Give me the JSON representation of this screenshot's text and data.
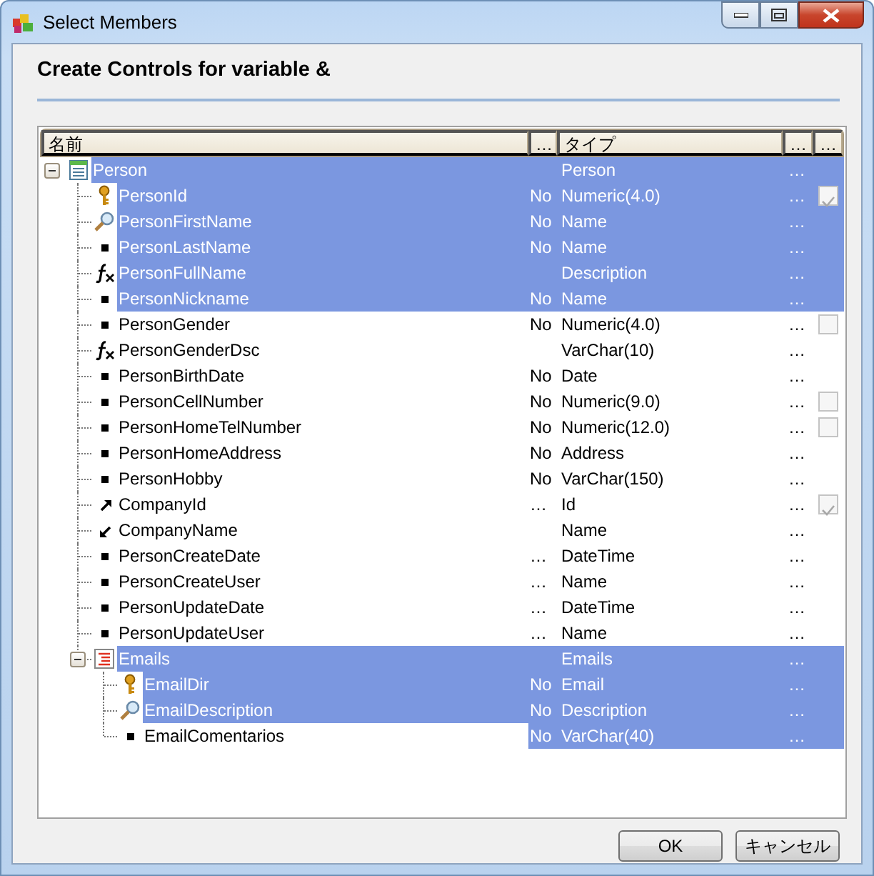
{
  "window": {
    "title": "Select Members"
  },
  "heading": "Create Controls for variable &",
  "columns": [
    {
      "label": "名前"
    },
    {
      "label": "…"
    },
    {
      "label": "タイプ"
    },
    {
      "label": "…"
    },
    {
      "label": "…"
    }
  ],
  "tree": [
    {
      "name": "Person",
      "kind": "table",
      "type": "Person",
      "more": "…",
      "selected": true,
      "name_selected": true,
      "expanded": true,
      "children": [
        {
          "name": "PersonId",
          "kind": "key",
          "nullable": "No",
          "type": "Numeric(4.0)",
          "more": "…",
          "checked": true,
          "selected": true,
          "name_selected": true
        },
        {
          "name": "PersonFirstName",
          "kind": "search",
          "nullable": "No",
          "type": "Name",
          "more": "…",
          "selected": true,
          "name_selected": true
        },
        {
          "name": "PersonLastName",
          "kind": "attribute",
          "nullable": "No",
          "type": "Name",
          "more": "…",
          "selected": true,
          "name_selected": true
        },
        {
          "name": "PersonFullName",
          "kind": "formula",
          "type": "Description",
          "more": "…",
          "selected": true,
          "name_selected": true
        },
        {
          "name": "PersonNickname",
          "kind": "attribute",
          "nullable": "No",
          "type": "Name",
          "more": "…",
          "selected": true,
          "name_selected": true
        },
        {
          "name": "PersonGender",
          "kind": "attribute",
          "nullable": "No",
          "type": "Numeric(4.0)",
          "more": "…",
          "checked": false,
          "selected": false,
          "name_selected": false
        },
        {
          "name": "PersonGenderDsc",
          "kind": "formula",
          "type": "VarChar(10)",
          "more": "…",
          "selected": false,
          "name_selected": false
        },
        {
          "name": "PersonBirthDate",
          "kind": "attribute",
          "nullable": "No",
          "type": "Date",
          "more": "…",
          "selected": false,
          "name_selected": false
        },
        {
          "name": "PersonCellNumber",
          "kind": "attribute",
          "nullable": "No",
          "type": "Numeric(9.0)",
          "more": "…",
          "checked": false,
          "selected": false,
          "name_selected": false
        },
        {
          "name": "PersonHomeTelNumber",
          "kind": "attribute",
          "nullable": "No",
          "type": "Numeric(12.0)",
          "more": "…",
          "checked": false,
          "selected": false,
          "name_selected": false
        },
        {
          "name": "PersonHomeAddress",
          "kind": "attribute",
          "nullable": "No",
          "type": "Address",
          "more": "…",
          "selected": false,
          "name_selected": false
        },
        {
          "name": "PersonHobby",
          "kind": "attribute",
          "nullable": "No",
          "type": "VarChar(150)",
          "more": "…",
          "selected": false,
          "name_selected": false
        },
        {
          "name": "CompanyId",
          "kind": "fk-out",
          "nullable": "…",
          "type": "Id",
          "more": "…",
          "checked": true,
          "selected": false,
          "name_selected": false
        },
        {
          "name": "CompanyName",
          "kind": "fk-in",
          "type": "Name",
          "more": "…",
          "selected": false,
          "name_selected": false
        },
        {
          "name": "PersonCreateDate",
          "kind": "attribute",
          "nullable": "…",
          "type": "DateTime",
          "more": "…",
          "selected": false,
          "name_selected": false
        },
        {
          "name": "PersonCreateUser",
          "kind": "attribute",
          "nullable": "…",
          "type": "Name",
          "more": "…",
          "selected": false,
          "name_selected": false
        },
        {
          "name": "PersonUpdateDate",
          "kind": "attribute",
          "nullable": "…",
          "type": "DateTime",
          "more": "…",
          "selected": false,
          "name_selected": false
        },
        {
          "name": "PersonUpdateUser",
          "kind": "attribute",
          "nullable": "…",
          "type": "Name",
          "more": "…",
          "selected": false,
          "name_selected": false
        },
        {
          "name": "Emails",
          "kind": "level",
          "type": "Emails",
          "more": "…",
          "selected": true,
          "name_selected": true,
          "expanded": true,
          "children": [
            {
              "name": "EmailDir",
              "kind": "key",
              "nullable": "No",
              "type": "Email",
              "more": "…",
              "selected": true,
              "name_selected": true
            },
            {
              "name": "EmailDescription",
              "kind": "search",
              "nullable": "No",
              "type": "Description",
              "more": "…",
              "selected": true,
              "name_selected": true
            },
            {
              "name": "EmailComentarios",
              "kind": "attribute",
              "nullable": "No",
              "type": "VarChar(40)",
              "more": "…",
              "selected": true,
              "name_selected": false
            }
          ]
        }
      ]
    }
  ],
  "buttons": [
    {
      "label": "OK"
    },
    {
      "label": "キャンセル"
    }
  ]
}
